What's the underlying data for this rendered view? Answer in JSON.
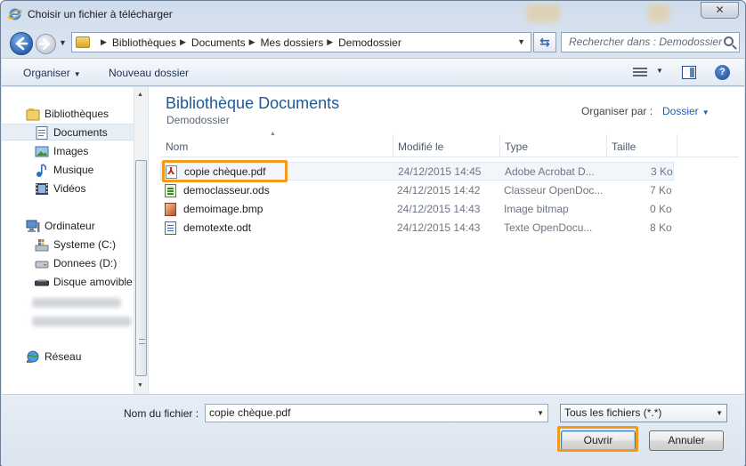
{
  "window": {
    "title": "Choisir un fichier à télécharger",
    "close_label": "✕"
  },
  "address": {
    "crumbs": [
      "Bibliothèques",
      "Documents",
      "Mes dossiers",
      "Demodossier"
    ],
    "search_placeholder": "Rechercher dans : Demodossier"
  },
  "toolbar": {
    "organize_label": "Organiser",
    "new_folder_label": "Nouveau dossier",
    "help_label": "?"
  },
  "nav": {
    "items": [
      {
        "label": "Bibliothèques",
        "icon": "libraries-icon"
      },
      {
        "label": "Documents",
        "icon": "documents-icon",
        "selected": true
      },
      {
        "label": "Images",
        "icon": "images-icon"
      },
      {
        "label": "Musique",
        "icon": "music-icon"
      },
      {
        "label": "Vidéos",
        "icon": "videos-icon"
      },
      {
        "label": "Ordinateur",
        "icon": "computer-icon"
      },
      {
        "label": "Systeme (C:)",
        "icon": "system-drive-icon"
      },
      {
        "label": "Donnees (D:)",
        "icon": "drive-icon"
      },
      {
        "label": "Disque amovible",
        "icon": "removable-drive-icon"
      },
      {
        "label": "Réseau",
        "icon": "network-icon"
      }
    ]
  },
  "main": {
    "library_title": "Bibliothèque Documents",
    "library_subtitle": "Demodossier",
    "arrange_label": "Organiser par :",
    "arrange_value": "Dossier",
    "columns": [
      "Nom",
      "Modifié le",
      "Type",
      "Taille"
    ],
    "files": [
      {
        "name": "copie chèque.pdf",
        "modified": "24/12/2015 14:45",
        "type": "Adobe Acrobat D...",
        "size": "3 Ko",
        "icon": "pdf-file-icon",
        "selected": true
      },
      {
        "name": "democlasseur.ods",
        "modified": "24/12/2015 14:42",
        "type": "Classeur OpenDoc...",
        "size": "7 Ko",
        "icon": "spreadsheet-file-icon"
      },
      {
        "name": "demoimage.bmp",
        "modified": "24/12/2015 14:43",
        "type": "Image bitmap",
        "size": "0 Ko",
        "icon": "image-file-icon"
      },
      {
        "name": "demotexte.odt",
        "modified": "24/12/2015 14:43",
        "type": "Texte OpenDocu...",
        "size": "8 Ko",
        "icon": "text-file-icon"
      }
    ]
  },
  "bottom": {
    "filename_label": "Nom du fichier :",
    "filename_value": "copie chèque.pdf",
    "filter_value": "Tous les fichiers (*.*)",
    "open_label": "Ouvrir",
    "cancel_label": "Annuler"
  },
  "colors": {
    "accent_highlight": "#f39a1c",
    "title_blue": "#1e5a96"
  }
}
